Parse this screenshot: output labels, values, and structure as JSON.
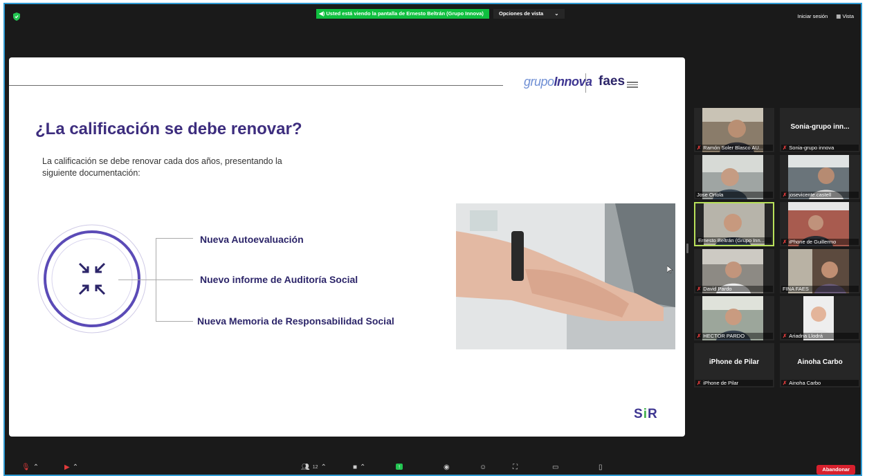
{
  "banner": {
    "sharing_text": "Usted está viendo la pantalla de Ernesto Beltrán (Grupo Innova)",
    "view_options_label": "Opciones de vista"
  },
  "top_right": {
    "signin_label": "Iniciar sesión",
    "view_label": "Vista"
  },
  "slide": {
    "logo_grupo_light": "grupo",
    "logo_grupo_bold": "Innova",
    "logo_faes": "faes",
    "title": "¿La calificación se debe renovar?",
    "subtitle": "La calificación se debe renovar cada dos años, presentando la siguiente documentación:",
    "items": [
      "Nueva Autoevaluación",
      "Nuevo informe de Auditoría Social",
      "Nueva Memoria de Responsabilidad Social"
    ],
    "sir_s": "S",
    "sir_i": "i",
    "sir_r": "R"
  },
  "participants": [
    {
      "name": "Ramón Soler Blasco AU...",
      "muted": true,
      "has_video": true
    },
    {
      "name": "Sonia-grupo innova",
      "big_name": "Sonia-grupo inn...",
      "muted": true,
      "has_video": false
    },
    {
      "name": "Jose Ortola",
      "muted": false,
      "has_video": true
    },
    {
      "name": "josevicente.castell",
      "muted": true,
      "has_video": true
    },
    {
      "name": "Ernesto Beltrán (Grupo Inn...",
      "muted": false,
      "has_video": true,
      "active": true
    },
    {
      "name": "iPhone de Guillermo",
      "muted": true,
      "has_video": true
    },
    {
      "name": "David Pardo",
      "muted": true,
      "has_video": true
    },
    {
      "name": "FINA FAES",
      "muted": false,
      "has_video": true
    },
    {
      "name": "HECTOR PARDO",
      "muted": true,
      "has_video": true
    },
    {
      "name": "Ariadna Llodrá",
      "muted": true,
      "has_video": true
    },
    {
      "name": "iPhone de Pilar",
      "big_name": "iPhone de Pilar",
      "muted": true,
      "has_video": false
    },
    {
      "name": "Ainoha Carbo",
      "big_name": "Ainoha Carbo",
      "muted": true,
      "has_video": false
    }
  ],
  "toolbar": {
    "participants_count": "12",
    "leave_label": "Abandonar"
  },
  "colors": {
    "share_green": "#0fbf3f",
    "frame_blue": "#2f9bd4",
    "title_purple": "#3d2d7e",
    "leave_red": "#d8202d",
    "active_speaker": "#b9e15a"
  }
}
